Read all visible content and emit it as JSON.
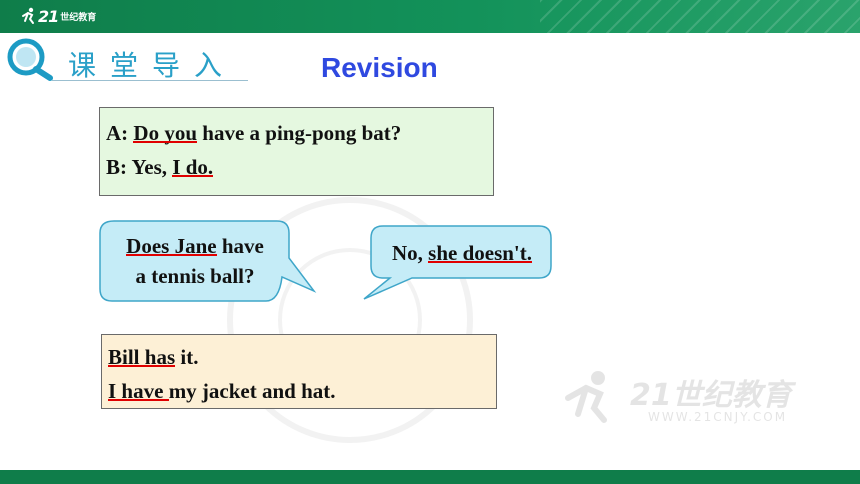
{
  "header": {
    "logo_mark": "21",
    "logo_text": "世纪教育"
  },
  "section": {
    "title": "课堂导入",
    "icon": "magnifier-icon"
  },
  "revision": "Revision",
  "dialog1": {
    "a_prefix": "A: ",
    "a_underlined": "Do you",
    "a_rest": " have a ping-pong bat?",
    "b_prefix": "B: Yes, ",
    "b_underlined": "I do."
  },
  "bubble_left": {
    "line1_underlined": "Does Jane",
    "line1_rest": " have",
    "line2": "a tennis ball?"
  },
  "bubble_right": {
    "prefix": "No, ",
    "underlined": "she doesn't."
  },
  "box_yellow": {
    "line1_underlined": "Bill has",
    "line1_rest": " it.",
    "line2_underlined": "I have ",
    "line2_rest": "my jacket and hat."
  },
  "watermark": {
    "big": "21世纪教育",
    "small": "WWW.21CNJY.COM"
  },
  "colors": {
    "header_green": "#0f7d4a",
    "title_blue": "#2aa0c8",
    "revision_blue": "#2f49e0",
    "underline_red": "#e00000",
    "bubble_fill": "#c5ecf7",
    "bubble_stroke": "#3fa6c9",
    "box_green": "#e5f8e0",
    "box_yellow": "#fdf0d6"
  }
}
